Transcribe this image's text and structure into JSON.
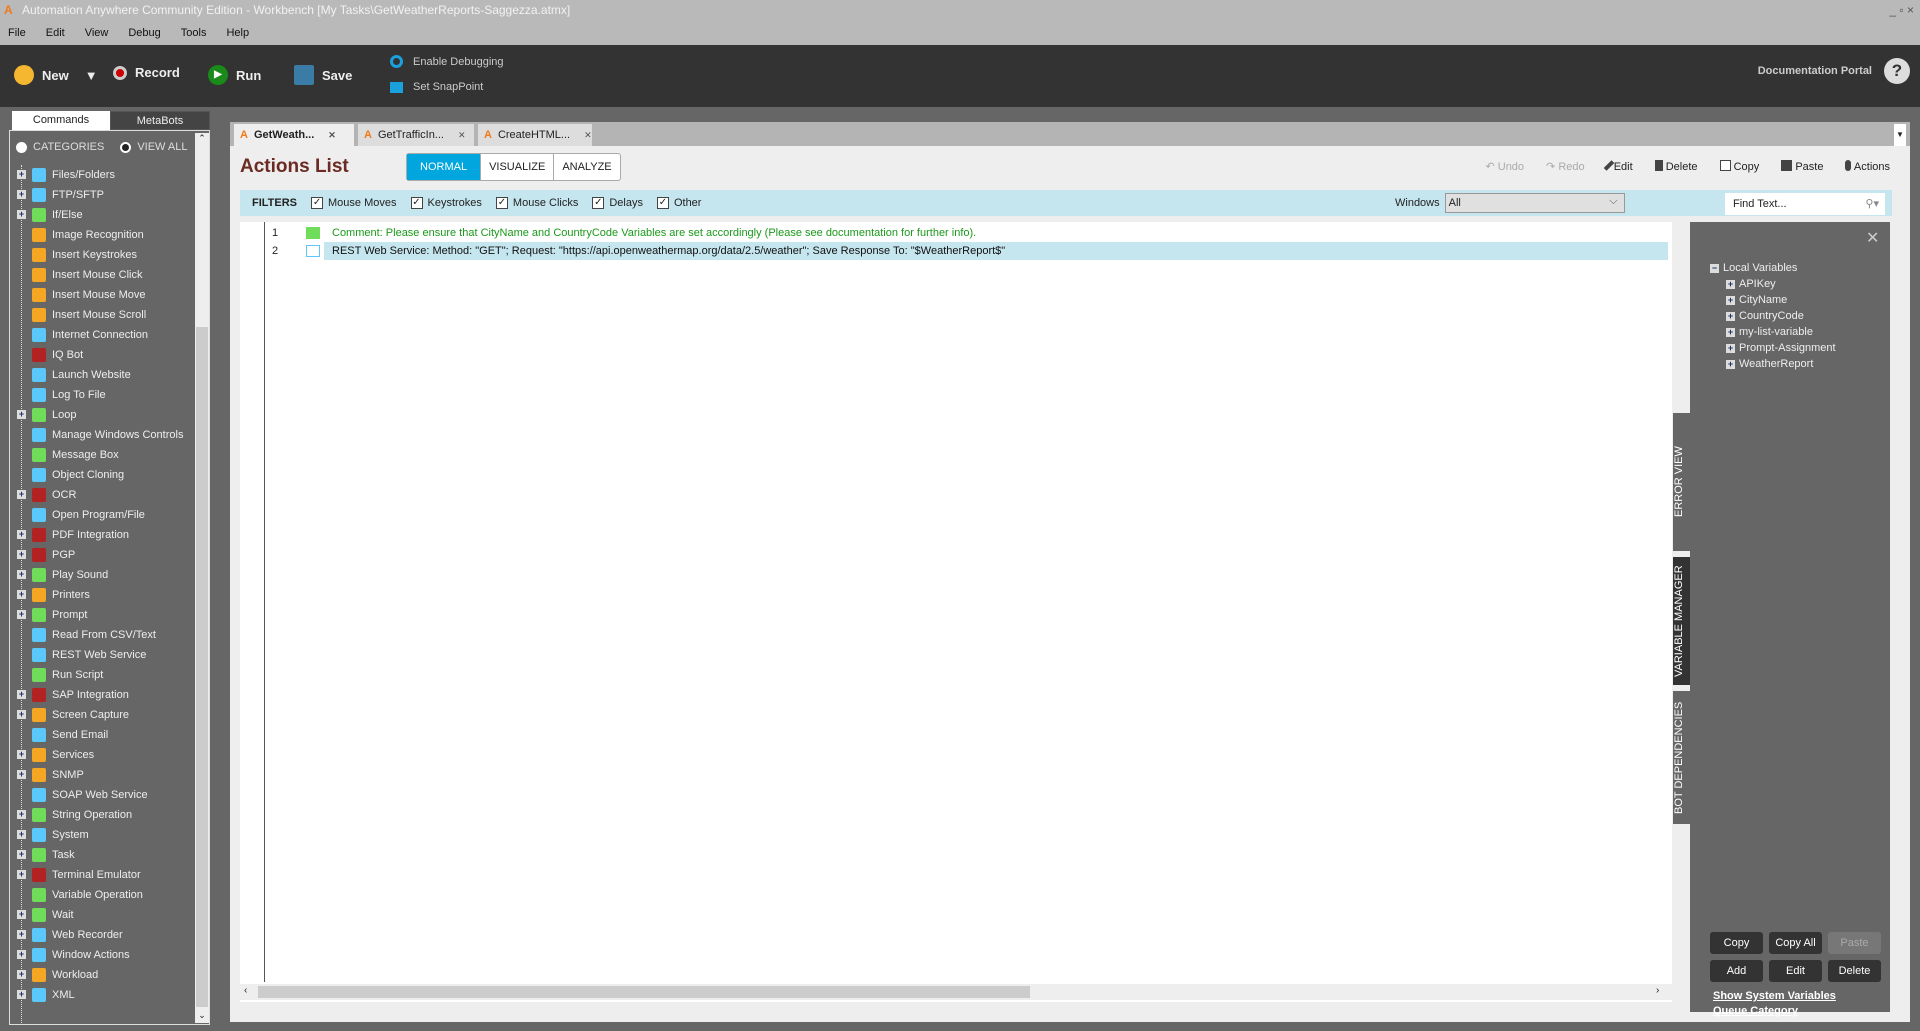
{
  "window": {
    "title": "Automation Anywhere Community Edition - Workbench [My Tasks\\GetWeatherReports-Saggezza.atmx]",
    "controls": "_ ▫ ×"
  },
  "menu": [
    "File",
    "Edit",
    "View",
    "Debug",
    "Tools",
    "Help"
  ],
  "toolbar": {
    "new": "New",
    "record": "Record",
    "run": "Run",
    "save": "Save",
    "enable_debugging": "Enable Debugging",
    "set_snappoint": "Set SnapPoint",
    "doc_portal": "Documentation Portal",
    "help": "?"
  },
  "sidebar": {
    "tabs": [
      "Commands",
      "MetaBots"
    ],
    "radio_categories": "CATEGORIES",
    "radio_view_all": "VIEW ALL",
    "commands": [
      {
        "label": "Files/Folders",
        "exp": true,
        "color": "#5ac8fa"
      },
      {
        "label": "FTP/SFTP",
        "exp": true,
        "color": "#5ac8fa"
      },
      {
        "label": "If/Else",
        "exp": true,
        "color": "#6fdc5a"
      },
      {
        "label": "Image Recognition",
        "exp": false,
        "color": "#f5a623"
      },
      {
        "label": "Insert Keystrokes",
        "exp": false,
        "color": "#f5a623"
      },
      {
        "label": "Insert Mouse Click",
        "exp": false,
        "color": "#f5a623"
      },
      {
        "label": "Insert Mouse Move",
        "exp": false,
        "color": "#f5a623"
      },
      {
        "label": "Insert Mouse Scroll",
        "exp": false,
        "color": "#f5a623"
      },
      {
        "label": "Internet Connection",
        "exp": false,
        "color": "#5ac8fa"
      },
      {
        "label": "IQ Bot",
        "exp": false,
        "color": "#b22222"
      },
      {
        "label": "Launch Website",
        "exp": false,
        "color": "#5ac8fa"
      },
      {
        "label": "Log To File",
        "exp": false,
        "color": "#5ac8fa"
      },
      {
        "label": "Loop",
        "exp": true,
        "color": "#6fdc5a"
      },
      {
        "label": "Manage Windows Controls",
        "exp": false,
        "color": "#5ac8fa"
      },
      {
        "label": "Message Box",
        "exp": false,
        "color": "#6fdc5a"
      },
      {
        "label": "Object Cloning",
        "exp": false,
        "color": "#5ac8fa"
      },
      {
        "label": "OCR",
        "exp": true,
        "color": "#b22222"
      },
      {
        "label": "Open Program/File",
        "exp": false,
        "color": "#5ac8fa"
      },
      {
        "label": "PDF Integration",
        "exp": true,
        "color": "#b22222"
      },
      {
        "label": "PGP",
        "exp": true,
        "color": "#b22222"
      },
      {
        "label": "Play Sound",
        "exp": true,
        "color": "#6fdc5a"
      },
      {
        "label": "Printers",
        "exp": true,
        "color": "#f5a623"
      },
      {
        "label": "Prompt",
        "exp": true,
        "color": "#6fdc5a"
      },
      {
        "label": "Read From CSV/Text",
        "exp": false,
        "color": "#5ac8fa"
      },
      {
        "label": "REST Web Service",
        "exp": false,
        "color": "#5ac8fa"
      },
      {
        "label": "Run Script",
        "exp": false,
        "color": "#6fdc5a"
      },
      {
        "label": "SAP Integration",
        "exp": true,
        "color": "#b22222"
      },
      {
        "label": "Screen Capture",
        "exp": true,
        "color": "#f5a623"
      },
      {
        "label": "Send Email",
        "exp": false,
        "color": "#5ac8fa"
      },
      {
        "label": "Services",
        "exp": true,
        "color": "#f5a623"
      },
      {
        "label": "SNMP",
        "exp": true,
        "color": "#f5a623"
      },
      {
        "label": "SOAP Web Service",
        "exp": false,
        "color": "#5ac8fa"
      },
      {
        "label": "String Operation",
        "exp": true,
        "color": "#6fdc5a"
      },
      {
        "label": "System",
        "exp": true,
        "color": "#5ac8fa"
      },
      {
        "label": "Task",
        "exp": true,
        "color": "#6fdc5a"
      },
      {
        "label": "Terminal Emulator",
        "exp": true,
        "color": "#b22222"
      },
      {
        "label": "Variable Operation",
        "exp": false,
        "color": "#6fdc5a"
      },
      {
        "label": "Wait",
        "exp": true,
        "color": "#6fdc5a"
      },
      {
        "label": "Web Recorder",
        "exp": true,
        "color": "#5ac8fa"
      },
      {
        "label": "Window Actions",
        "exp": true,
        "color": "#5ac8fa"
      },
      {
        "label": "Workload",
        "exp": true,
        "color": "#f5a623"
      },
      {
        "label": "XML",
        "exp": true,
        "color": "#5ac8fa"
      }
    ]
  },
  "file_tabs": [
    {
      "label": "GetWeath..."
    },
    {
      "label": "GetTrafficIn..."
    },
    {
      "label": "CreateHTML..."
    }
  ],
  "actions": {
    "title": "Actions List",
    "views": [
      "NORMAL",
      "VISUALIZE",
      "ANALYZE"
    ],
    "active_view": "NORMAL",
    "buttons": {
      "undo": "Undo",
      "redo": "Redo",
      "edit": "Edit",
      "delete": "Delete",
      "copy": "Copy",
      "paste": "Paste",
      "actions": "Actions"
    }
  },
  "filters": {
    "label": "FILTERS",
    "items": [
      "Mouse Moves",
      "Keystrokes",
      "Mouse Clicks",
      "Delays",
      "Other"
    ],
    "windows_label": "Windows",
    "windows_value": "All",
    "find_placeholder": "Find Text..."
  },
  "lines": [
    {
      "n": "1",
      "text": "Comment: Please ensure that CityName and CountryCode Variables are set accordingly (Please see documentation for further info).",
      "color": "#1a9a1a"
    },
    {
      "n": "2",
      "text": "REST Web Service: Method: \"GET\"; Request: \"https://api.openweathermap.org/data/2.5/weather\"; Save Response To: \"$WeatherReport$\"",
      "color": "#111"
    }
  ],
  "side_tabs": [
    "ERROR VIEW",
    "VARIABLE MANAGER",
    "BOT DEPENDENCIES"
  ],
  "variables": {
    "root": "Local Variables",
    "items": [
      "APIKey",
      "CityName",
      "CountryCode",
      "my-list-variable",
      "Prompt-Assignment",
      "WeatherReport"
    ],
    "buttons": {
      "copy": "Copy",
      "copy_all": "Copy All",
      "paste": "Paste",
      "add": "Add",
      "edit": "Edit",
      "delete": "Delete"
    },
    "show_system": "Show System Variables",
    "queue_category": "Queue Category"
  }
}
